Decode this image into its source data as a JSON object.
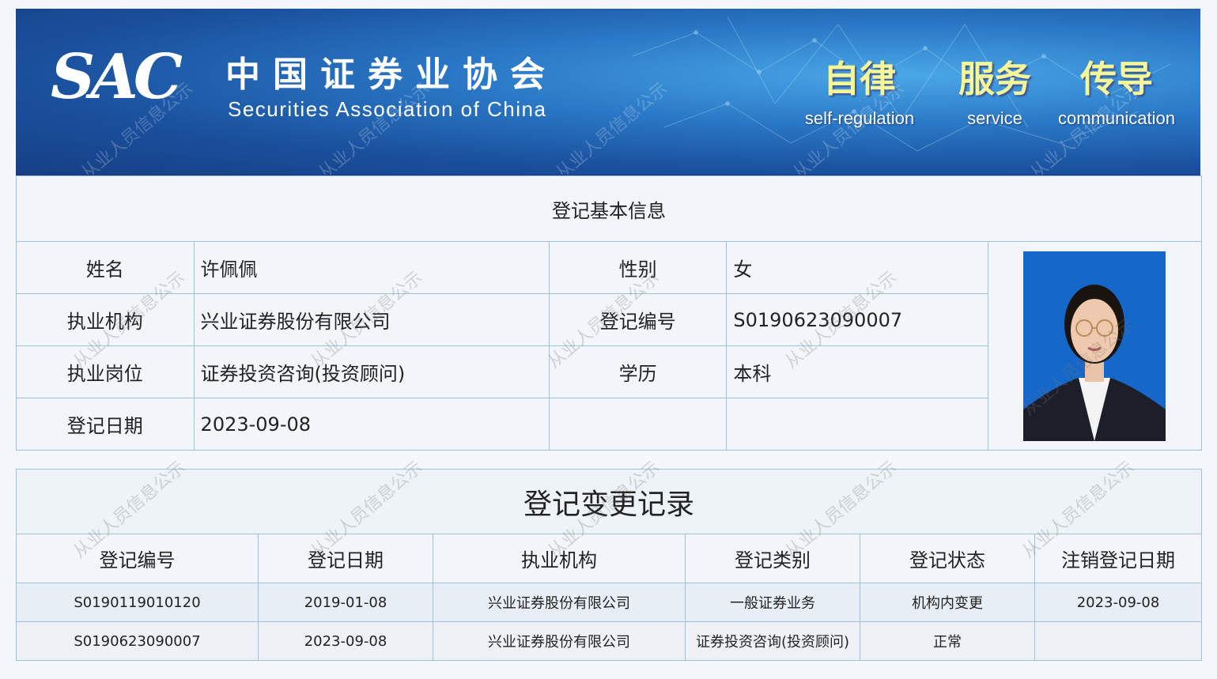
{
  "header": {
    "logo_text": "SAC",
    "org_name_cn": "中国证券业协会",
    "org_name_en": "Securities Association of China",
    "slogans": [
      {
        "cn": "自律",
        "en": "self-regulation"
      },
      {
        "cn": "服务",
        "en": "service"
      },
      {
        "cn": "传导",
        "en": "communication"
      }
    ]
  },
  "watermark": "从业人员信息公示",
  "basic": {
    "title": "登记基本信息",
    "labels": {
      "name": "姓名",
      "gender": "性别",
      "institution": "执业机构",
      "reg_no": "登记编号",
      "position": "执业岗位",
      "education": "学历",
      "reg_date": "登记日期"
    },
    "values": {
      "name": "许佩佩",
      "gender": "女",
      "institution": "兴业证券股份有限公司",
      "reg_no": "S0190623090007",
      "position": "证券投资咨询(投资顾问)",
      "education": "本科",
      "reg_date": "2023-09-08"
    }
  },
  "changes": {
    "title": "登记变更记录",
    "columns": [
      "登记编号",
      "登记日期",
      "执业机构",
      "登记类别",
      "登记状态",
      "注销登记日期"
    ],
    "rows": [
      [
        "S0190119010120",
        "2019-01-08",
        "兴业证券股份有限公司",
        "一般证券业务",
        "机构内变更",
        "2023-09-08"
      ],
      [
        "S0190623090007",
        "2023-09-08",
        "兴业证券股份有限公司",
        "证券投资咨询(投资顾问)",
        "正常",
        ""
      ]
    ]
  }
}
